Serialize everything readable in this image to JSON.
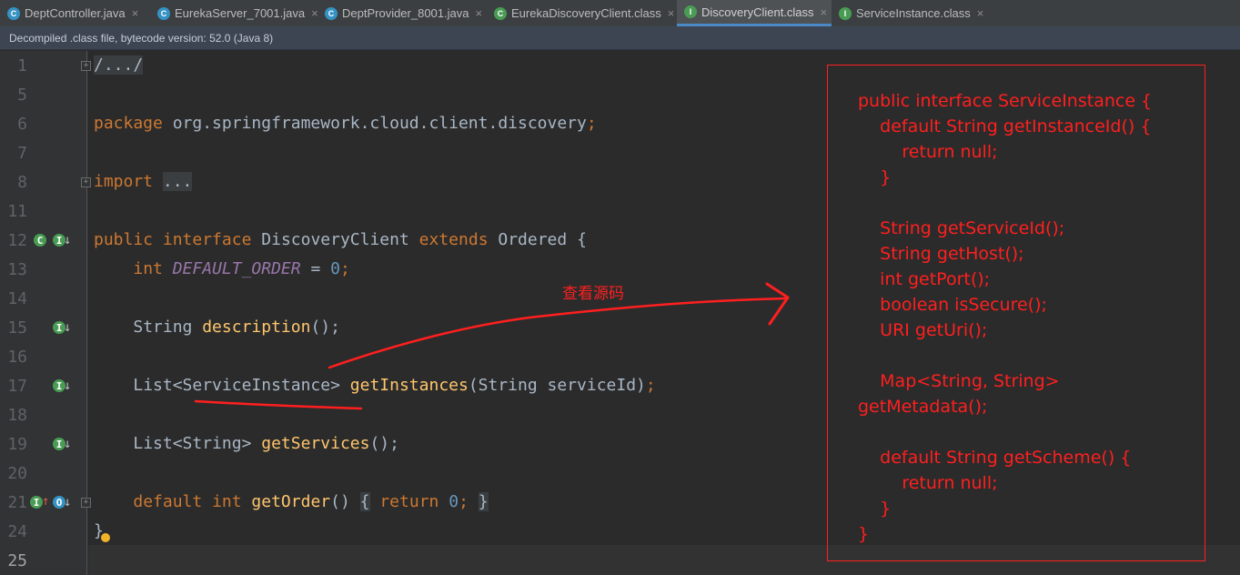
{
  "tabs": [
    {
      "label": "DeptController.java",
      "icon": "C",
      "kind": "java",
      "active": false
    },
    {
      "label": "EurekaServer_7001.java",
      "icon": "C",
      "kind": "java",
      "active": false
    },
    {
      "label": "DeptProvider_8001.java",
      "icon": "C",
      "kind": "java",
      "active": false
    },
    {
      "label": "EurekaDiscoveryClient.class",
      "icon": "C",
      "kind": "cls",
      "active": false
    },
    {
      "label": "DiscoveryClient.class",
      "icon": "I",
      "kind": "cls",
      "active": true
    },
    {
      "label": "ServiceInstance.class",
      "icon": "I",
      "kind": "cls",
      "active": false
    }
  ],
  "infobar": {
    "text": "Decompiled .class file, bytecode version: 52.0 (Java 8)"
  },
  "line_numbers": [
    "1",
    "5",
    "6",
    "7",
    "8",
    "11",
    "12",
    "13",
    "14",
    "15",
    "16",
    "17",
    "18",
    "19",
    "20",
    "21",
    "24",
    "25"
  ],
  "code": {
    "l1": "/.../",
    "l6_kw": "package",
    "l6_rest": " org.springframework.cloud.client.discovery",
    "l6_semi": ";",
    "l8_kw": "import",
    "l8_rest": "...",
    "l12_kw1": "public",
    "l12_kw2": "interface",
    "l12_name": "DiscoveryClient",
    "l12_kw3": "extends",
    "l12_base": "Ordered",
    "l12_brace": "{",
    "l13_type": "int",
    "l13_const": "DEFAULT_ORDER",
    "l13_eq": " = ",
    "l13_num": "0",
    "l13_semi": ";",
    "l15_type": "String ",
    "l15_fn": "description",
    "l15_end": "();",
    "l17_type": "List<ServiceInstance> ",
    "l17_fn": "getInstances",
    "l17_args": "(String serviceId)",
    "l17_semi": ";",
    "l19_type": "List<String> ",
    "l19_fn": "getServices",
    "l19_end": "();",
    "l21_kw1": "default",
    "l21_kw2": "int",
    "l21_fn": "getOrder",
    "l21_paren": "()",
    "l21_open": "{",
    "l21_ret": "return",
    "l21_num": "0",
    "l21_semi": ";",
    "l21_close": "}",
    "l24": "}"
  },
  "annotation": {
    "text": "查看源码"
  },
  "source_box": {
    "lines": [
      "public interface ServiceInstance {",
      "    default String getInstanceId() {",
      "        return null;",
      "    }",
      "",
      "    String getServiceId();",
      "    String getHost();",
      "    int getPort();",
      "    boolean isSecure();",
      "    URI getUri();",
      "",
      "    Map<String, String>",
      "getMetadata();",
      "",
      "    default String getScheme() {",
      "        return null;",
      "    }",
      "}"
    ]
  },
  "colors": {
    "annotation": "#ff1f1f",
    "keyword": "#cc7832",
    "function": "#ffc66d"
  }
}
